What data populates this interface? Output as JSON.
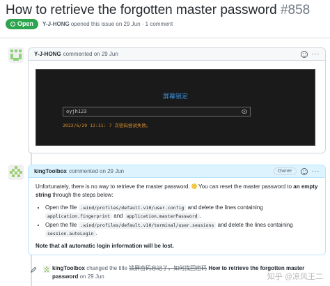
{
  "issue": {
    "title": "How to retrieve the forgotten master password",
    "number": "#858",
    "state": "Open",
    "opener": "Y-J-HONG",
    "opened_text": "opened this issue on 29 Jun · 1 comment"
  },
  "comments": [
    {
      "author": "Y-J-HONG",
      "meta": "commented on 29 Jun",
      "screenshot": {
        "title": "屏幕锁定",
        "password_value": "oyjh123",
        "message": "2022/6/29 12:11: 7 次密码尝试失败。"
      }
    },
    {
      "author": "kingToolbox",
      "meta": "commented on 29 Jun",
      "owner_label": "Owner",
      "body": {
        "p1_a": "Unfortunately, there is no way to retrieve the master password.",
        "p1_b": "You can reset the master password to",
        "p1_bold": "an empty string",
        "p1_c": "through the steps below:",
        "li1_a": "Open the file",
        "li1_code1": ".wind/profiles/default.v10/user.config",
        "li1_b": "and delete the lines containing",
        "li1_code2": "application.fingerprint",
        "li1_c": "and",
        "li1_code3": "application.masterPassword",
        "li1_d": ".",
        "li2_a": "Open the file",
        "li2_code1": ".wind/profiles/default.v10/terminal/user.sessions",
        "li2_b": "and delete the lines containing",
        "li2_code2": "session.autoLogin",
        "li2_c": ".",
        "note": "Note that all automatic login information will be lost."
      }
    }
  ],
  "event": {
    "actor": "kingToolbox",
    "action": "changed the title",
    "old_title": "锁屏密码忘记了，如何找回密码",
    "new_title": "How to retrieve the forgotten master password",
    "date": "on 29 Jun"
  },
  "watermark": "知乎 @凉风王二",
  "colors": {
    "open_badge": "#2da44e",
    "owner_header": "#ddf4ff",
    "screenshot_bg": "#1a1a1a",
    "screenshot_title": "#3b8ed8",
    "screenshot_message": "#d9902f"
  }
}
